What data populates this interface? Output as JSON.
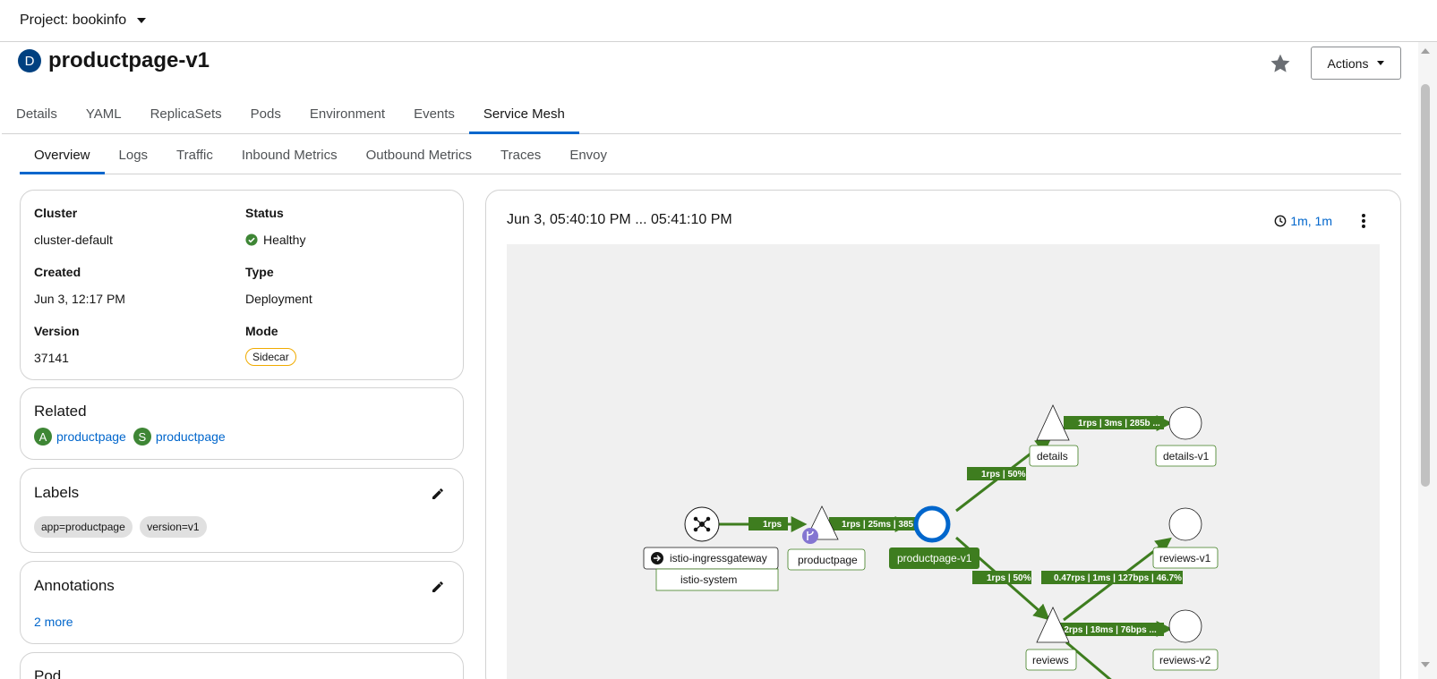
{
  "project": {
    "label": "Project: bookinfo"
  },
  "resource": {
    "badge": "D",
    "name": "productpage-v1"
  },
  "header": {
    "actions_label": "Actions"
  },
  "tabs_primary": [
    {
      "label": "Details"
    },
    {
      "label": "YAML"
    },
    {
      "label": "ReplicaSets"
    },
    {
      "label": "Pods"
    },
    {
      "label": "Environment"
    },
    {
      "label": "Events"
    },
    {
      "label": "Service Mesh",
      "active": true
    }
  ],
  "tabs_secondary": [
    {
      "label": "Overview",
      "active": true
    },
    {
      "label": "Logs"
    },
    {
      "label": "Traffic"
    },
    {
      "label": "Inbound Metrics"
    },
    {
      "label": "Outbound Metrics"
    },
    {
      "label": "Traces"
    },
    {
      "label": "Envoy"
    }
  ],
  "overview": {
    "cluster_label": "Cluster",
    "cluster_value": "cluster-default",
    "status_label": "Status",
    "status_value": "Healthy",
    "created_label": "Created",
    "created_value": "Jun 3, 12:17 PM",
    "type_label": "Type",
    "type_value": "Deployment",
    "version_label": "Version",
    "version_value": "37141",
    "mode_label": "Mode",
    "mode_value": "Sidecar"
  },
  "related": {
    "title": "Related",
    "items": [
      {
        "badge": "A",
        "name": "productpage"
      },
      {
        "badge": "S",
        "name": "productpage"
      }
    ]
  },
  "labels": {
    "title": "Labels",
    "chips": [
      "app=productpage",
      "version=v1"
    ]
  },
  "annotations": {
    "title": "Annotations",
    "more_link": "2 more"
  },
  "partial_card": {
    "title": "Pod"
  },
  "graph": {
    "time_range": "Jun 3, 05:40:10 PM ... 05:41:10 PM",
    "refresh": "1m, 1m",
    "nodes": {
      "gateway": "istio-ingressgateway",
      "gateway_ns": "istio-system",
      "productpage": "productpage",
      "productpage_v1": "productpage-v1",
      "details": "details",
      "details_v1": "details-v1",
      "reviews": "reviews",
      "reviews_v1": "reviews-v1",
      "reviews_v2": "reviews-v2"
    },
    "edges": {
      "gw_to_pp": "1rps",
      "pp_to_ppv1": "1rps | 25ms | 385 ...",
      "ppv1_to_details": "1rps | 50%",
      "details_to_v1": "1rps | 3ms | 285b ...",
      "ppv1_to_reviews": "1rps | 50%",
      "reviews_to_v1": "0.47rps | 1ms | 127bps | 46.7%",
      "reviews_to_v2": "...2rps | 18ms | 76bps ..."
    },
    "colors": {
      "edge": "#3e7d1f",
      "focus_ring": "#0066cc",
      "focus_label_bg": "#3e7d1f"
    }
  }
}
